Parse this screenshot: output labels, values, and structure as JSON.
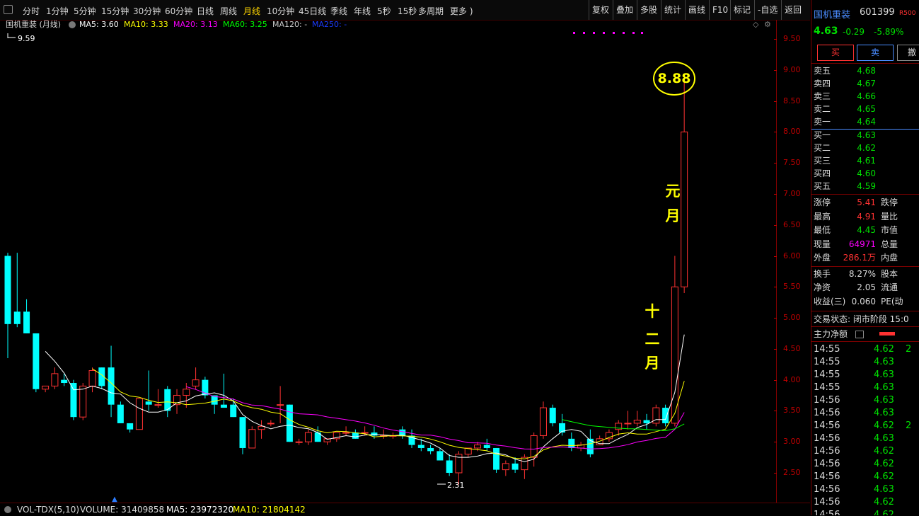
{
  "toolbar": {
    "tabs": [
      "分时",
      "1分钟",
      "5分钟",
      "15分钟",
      "30分钟",
      "60分钟",
      "日线",
      "周线",
      "月线",
      "10分钟",
      "45日线",
      "季线",
      "年线",
      "5秒",
      "15秒",
      "多周期",
      "更多 )"
    ],
    "active_tab": "月线",
    "right_buttons": [
      "复权",
      "叠加",
      "多股",
      "统计",
      "画线",
      "F10",
      "标记",
      "-自选",
      "返回"
    ]
  },
  "indicators": {
    "title": "国机重装 (月线)",
    "ma5": "MA5: 3.60",
    "ma10": "MA10: 3.33",
    "ma20": "MA20: 3.13",
    "ma60": "MA60: 3.25",
    "ma120": "MA120: -",
    "ma250": "MA250: -"
  },
  "annotations": {
    "high_label": "8.88",
    "top_left_high": "9.59",
    "low_label": "2.31",
    "text_yuan": "元",
    "text_yue": "月",
    "text_shi": "十",
    "text_er": "二",
    "text_yue2": "月"
  },
  "axis_ticks": [
    "9.50",
    "9.00",
    "8.50",
    "8.00",
    "7.50",
    "7.00",
    "6.50",
    "6.00",
    "5.50",
    "5.00",
    "4.50",
    "4.00",
    "3.50",
    "3.00",
    "2.50"
  ],
  "volume_bar": {
    "label": "VOL-TDX(5,10)",
    "volume": "VOLUME: 31409858",
    "ma5": "MA5: 23972320",
    "ma10": "MA10: 21804142"
  },
  "colors": {
    "up": "#ff3232",
    "down": "#00ffff",
    "ma5": "#ffffff",
    "ma10": "#ffff00",
    "ma20": "#ff00ff",
    "ma60": "#00ff00",
    "ma250": "#0000ff"
  },
  "chart_data": {
    "type": "candlestick",
    "title": "国机重装 (月线)",
    "ylim": [
      2.3,
      9.7
    ],
    "ohlc": [
      [
        6.0,
        6.05,
        4.35,
        4.9
      ],
      [
        5.1,
        6.05,
        4.85,
        4.9
      ],
      [
        5.1,
        5.3,
        4.75,
        4.75
      ],
      [
        4.75,
        4.75,
        3.8,
        3.85
      ],
      [
        3.85,
        3.9,
        3.8,
        3.9
      ],
      [
        3.9,
        4.2,
        3.85,
        4.1
      ],
      [
        4.0,
        4.1,
        3.9,
        3.95
      ],
      [
        3.95,
        4.0,
        3.35,
        3.4
      ],
      [
        3.4,
        3.95,
        3.35,
        3.9
      ],
      [
        3.9,
        4.2,
        3.8,
        4.15
      ],
      [
        4.2,
        4.2,
        3.85,
        3.9
      ],
      [
        4.2,
        4.55,
        3.4,
        3.6
      ],
      [
        3.6,
        3.65,
        3.3,
        3.3
      ],
      [
        3.3,
        3.3,
        3.15,
        3.2
      ],
      [
        3.2,
        3.7,
        3.2,
        3.7
      ],
      [
        3.65,
        4.15,
        3.5,
        3.6
      ],
      [
        3.6,
        3.85,
        3.55,
        3.6
      ],
      [
        3.85,
        3.9,
        3.4,
        3.5
      ],
      [
        3.6,
        3.85,
        3.45,
        3.75
      ],
      [
        3.75,
        3.95,
        3.55,
        3.85
      ],
      [
        3.9,
        4.2,
        3.85,
        4.0
      ],
      [
        4.0,
        4.05,
        3.7,
        3.75
      ],
      [
        3.75,
        3.75,
        3.45,
        3.6
      ],
      [
        3.6,
        4.1,
        3.55,
        3.55
      ],
      [
        3.6,
        3.7,
        3.4,
        3.4
      ],
      [
        3.4,
        3.4,
        2.8,
        2.9
      ],
      [
        2.9,
        3.25,
        2.95,
        3.2
      ],
      [
        3.2,
        3.35,
        3.05,
        3.25
      ],
      [
        3.3,
        3.35,
        3.25,
        3.3
      ],
      [
        3.6,
        3.9,
        3.3,
        3.6
      ],
      [
        3.6,
        3.6,
        3.0,
        3.0
      ],
      [
        3.0,
        3.05,
        2.95,
        3.0
      ],
      [
        3.0,
        3.2,
        2.95,
        3.15
      ],
      [
        3.15,
        3.25,
        3.0,
        3.0
      ],
      [
        3.0,
        3.0,
        2.95,
        3.05
      ],
      [
        3.05,
        3.15,
        3.0,
        3.15
      ],
      [
        3.15,
        3.25,
        3.1,
        3.15
      ],
      [
        3.15,
        3.2,
        3.05,
        3.05
      ],
      [
        3.15,
        3.25,
        3.1,
        3.15
      ],
      [
        3.15,
        3.25,
        3.05,
        3.1
      ],
      [
        3.1,
        3.2,
        3.05,
        3.1
      ],
      [
        3.1,
        3.15,
        3.05,
        3.1
      ],
      [
        3.2,
        3.25,
        3.05,
        3.1
      ],
      [
        3.1,
        3.2,
        2.9,
        2.95
      ],
      [
        2.95,
        3.05,
        2.85,
        2.9
      ],
      [
        2.9,
        2.95,
        2.8,
        2.85
      ],
      [
        2.85,
        2.9,
        2.7,
        2.7
      ],
      [
        2.7,
        2.8,
        2.45,
        2.5
      ],
      [
        2.5,
        2.85,
        2.31,
        2.8
      ],
      [
        2.8,
        2.9,
        2.75,
        2.9
      ],
      [
        2.9,
        3.0,
        2.85,
        2.95
      ],
      [
        2.95,
        3.05,
        2.85,
        2.9
      ],
      [
        2.9,
        2.9,
        2.5,
        2.55
      ],
      [
        2.55,
        2.7,
        2.45,
        2.65
      ],
      [
        2.65,
        2.75,
        2.5,
        2.55
      ],
      [
        2.55,
        2.8,
        2.4,
        2.75
      ],
      [
        2.75,
        3.15,
        2.6,
        3.1
      ],
      [
        3.1,
        3.65,
        3.05,
        3.55
      ],
      [
        3.55,
        3.6,
        3.25,
        3.3
      ],
      [
        3.3,
        3.45,
        3.1,
        3.15
      ],
      [
        3.05,
        3.15,
        2.85,
        2.9
      ],
      [
        2.9,
        3.0,
        2.85,
        2.95
      ],
      [
        3.05,
        3.2,
        2.75,
        2.8
      ],
      [
        2.95,
        3.1,
        2.95,
        3.05
      ],
      [
        3.05,
        3.2,
        3.0,
        3.15
      ],
      [
        3.2,
        3.35,
        3.1,
        3.3
      ],
      [
        3.3,
        3.5,
        3.2,
        3.3
      ],
      [
        3.3,
        3.5,
        3.25,
        3.35
      ],
      [
        3.35,
        3.45,
        3.2,
        3.3
      ],
      [
        3.3,
        3.6,
        3.25,
        3.55
      ],
      [
        3.55,
        3.6,
        3.25,
        3.3
      ],
      [
        3.3,
        6.0,
        3.25,
        5.5
      ],
      [
        5.5,
        8.88,
        5.4,
        8.0
      ]
    ]
  },
  "panel": {
    "name": "国机重装",
    "code": "601399",
    "badge": "R500",
    "price": "4.63",
    "change": "-0.29",
    "pct": "-5.89%",
    "buy_btn": "买",
    "sell_btn": "卖",
    "cancel_btn": "撤",
    "asks": [
      {
        "label": "卖五",
        "price": "4.68"
      },
      {
        "label": "卖四",
        "price": "4.67"
      },
      {
        "label": "卖三",
        "price": "4.66"
      },
      {
        "label": "卖二",
        "price": "4.65"
      },
      {
        "label": "卖一",
        "price": "4.64"
      }
    ],
    "bids": [
      {
        "label": "买一",
        "price": "4.63"
      },
      {
        "label": "买二",
        "price": "4.62"
      },
      {
        "label": "买三",
        "price": "4.61"
      },
      {
        "label": "买四",
        "price": "4.60"
      },
      {
        "label": "买五",
        "price": "4.59"
      }
    ],
    "stats": [
      {
        "l": "涨停",
        "v": "5.41",
        "r": "跌停",
        "vc": "#ff3232"
      },
      {
        "l": "最高",
        "v": "4.91",
        "r": "量比",
        "vc": "#ff3232"
      },
      {
        "l": "最低",
        "v": "4.45",
        "r": "市值",
        "vc": "#00e000"
      },
      {
        "l": "现量",
        "v": "64971",
        "r": "总量",
        "vc": "#ff00ff"
      },
      {
        "l": "外盘",
        "v": "286.1万",
        "r": "内盘",
        "vc": "#ff3232"
      }
    ],
    "stats2": [
      {
        "l": "换手",
        "v": "8.27%",
        "r": "股本"
      },
      {
        "l": "净资",
        "v": "2.05",
        "r": "流通"
      },
      {
        "l": "收益(三)",
        "v": "0.060",
        "r": "PE(动"
      }
    ],
    "trade_status": "交易状态: 闭市阶段 15:0",
    "main_flow": "主力净额",
    "ticks": [
      {
        "t": "14:55",
        "p": "4.62",
        "n": "2"
      },
      {
        "t": "14:55",
        "p": "4.63",
        "n": ""
      },
      {
        "t": "14:55",
        "p": "4.63",
        "n": ""
      },
      {
        "t": "14:55",
        "p": "4.63",
        "n": ""
      },
      {
        "t": "14:56",
        "p": "4.63",
        "n": ""
      },
      {
        "t": "14:56",
        "p": "4.63",
        "n": ""
      },
      {
        "t": "14:56",
        "p": "4.62",
        "n": "2"
      },
      {
        "t": "14:56",
        "p": "4.63",
        "n": ""
      },
      {
        "t": "14:56",
        "p": "4.62",
        "n": ""
      },
      {
        "t": "14:56",
        "p": "4.62",
        "n": ""
      },
      {
        "t": "14:56",
        "p": "4.62",
        "n": ""
      },
      {
        "t": "14:56",
        "p": "4.63",
        "n": ""
      },
      {
        "t": "14:56",
        "p": "4.62",
        "n": ""
      },
      {
        "t": "14:56",
        "p": "4.62",
        "n": ""
      },
      {
        "t": "14:56",
        "p": "4.62",
        "n": ""
      }
    ]
  }
}
